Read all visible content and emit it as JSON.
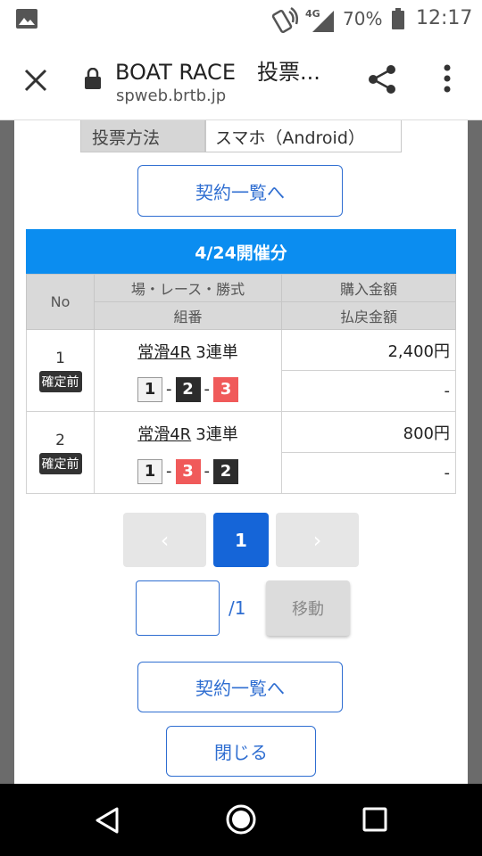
{
  "status_bar": {
    "network": "4G",
    "battery": "70%",
    "time": "12:17"
  },
  "browser": {
    "title": "BOAT RACE　投票...",
    "url": "spweb.brtb.jp"
  },
  "vote_method": {
    "label": "投票方法",
    "value": "スマホ（Android）"
  },
  "buttons": {
    "contract_list": "契約一覧へ",
    "close": "閉じる",
    "move": "移動"
  },
  "section_title": "4/24開催分",
  "table": {
    "headers": {
      "no": "No",
      "venue_race_type": "場・レース・勝式",
      "combination": "組番",
      "purchase_amount": "購入金額",
      "payout_amount": "払戻金額"
    },
    "rows": [
      {
        "no": "1",
        "status": "確定前",
        "venue_race": "常滑4R",
        "bet_type": "3連単",
        "combo": [
          "1",
          "2",
          "3"
        ],
        "purchase": "2,400円",
        "payout": "-"
      },
      {
        "no": "2",
        "status": "確定前",
        "venue_race": "常滑4R",
        "bet_type": "3連単",
        "combo": [
          "1",
          "3",
          "2"
        ],
        "purchase": "800円",
        "payout": "-"
      }
    ]
  },
  "pagination": {
    "prev": "‹",
    "current": "1",
    "next": "›",
    "total": "/1"
  },
  "colors": {
    "header_blue": "#0b8df0",
    "link_blue": "#2f6ed1",
    "current_page": "#1565d8",
    "boat_1": "#f2f2f2",
    "boat_2": "#2c2c2c",
    "boat_3": "#f05a5a"
  }
}
